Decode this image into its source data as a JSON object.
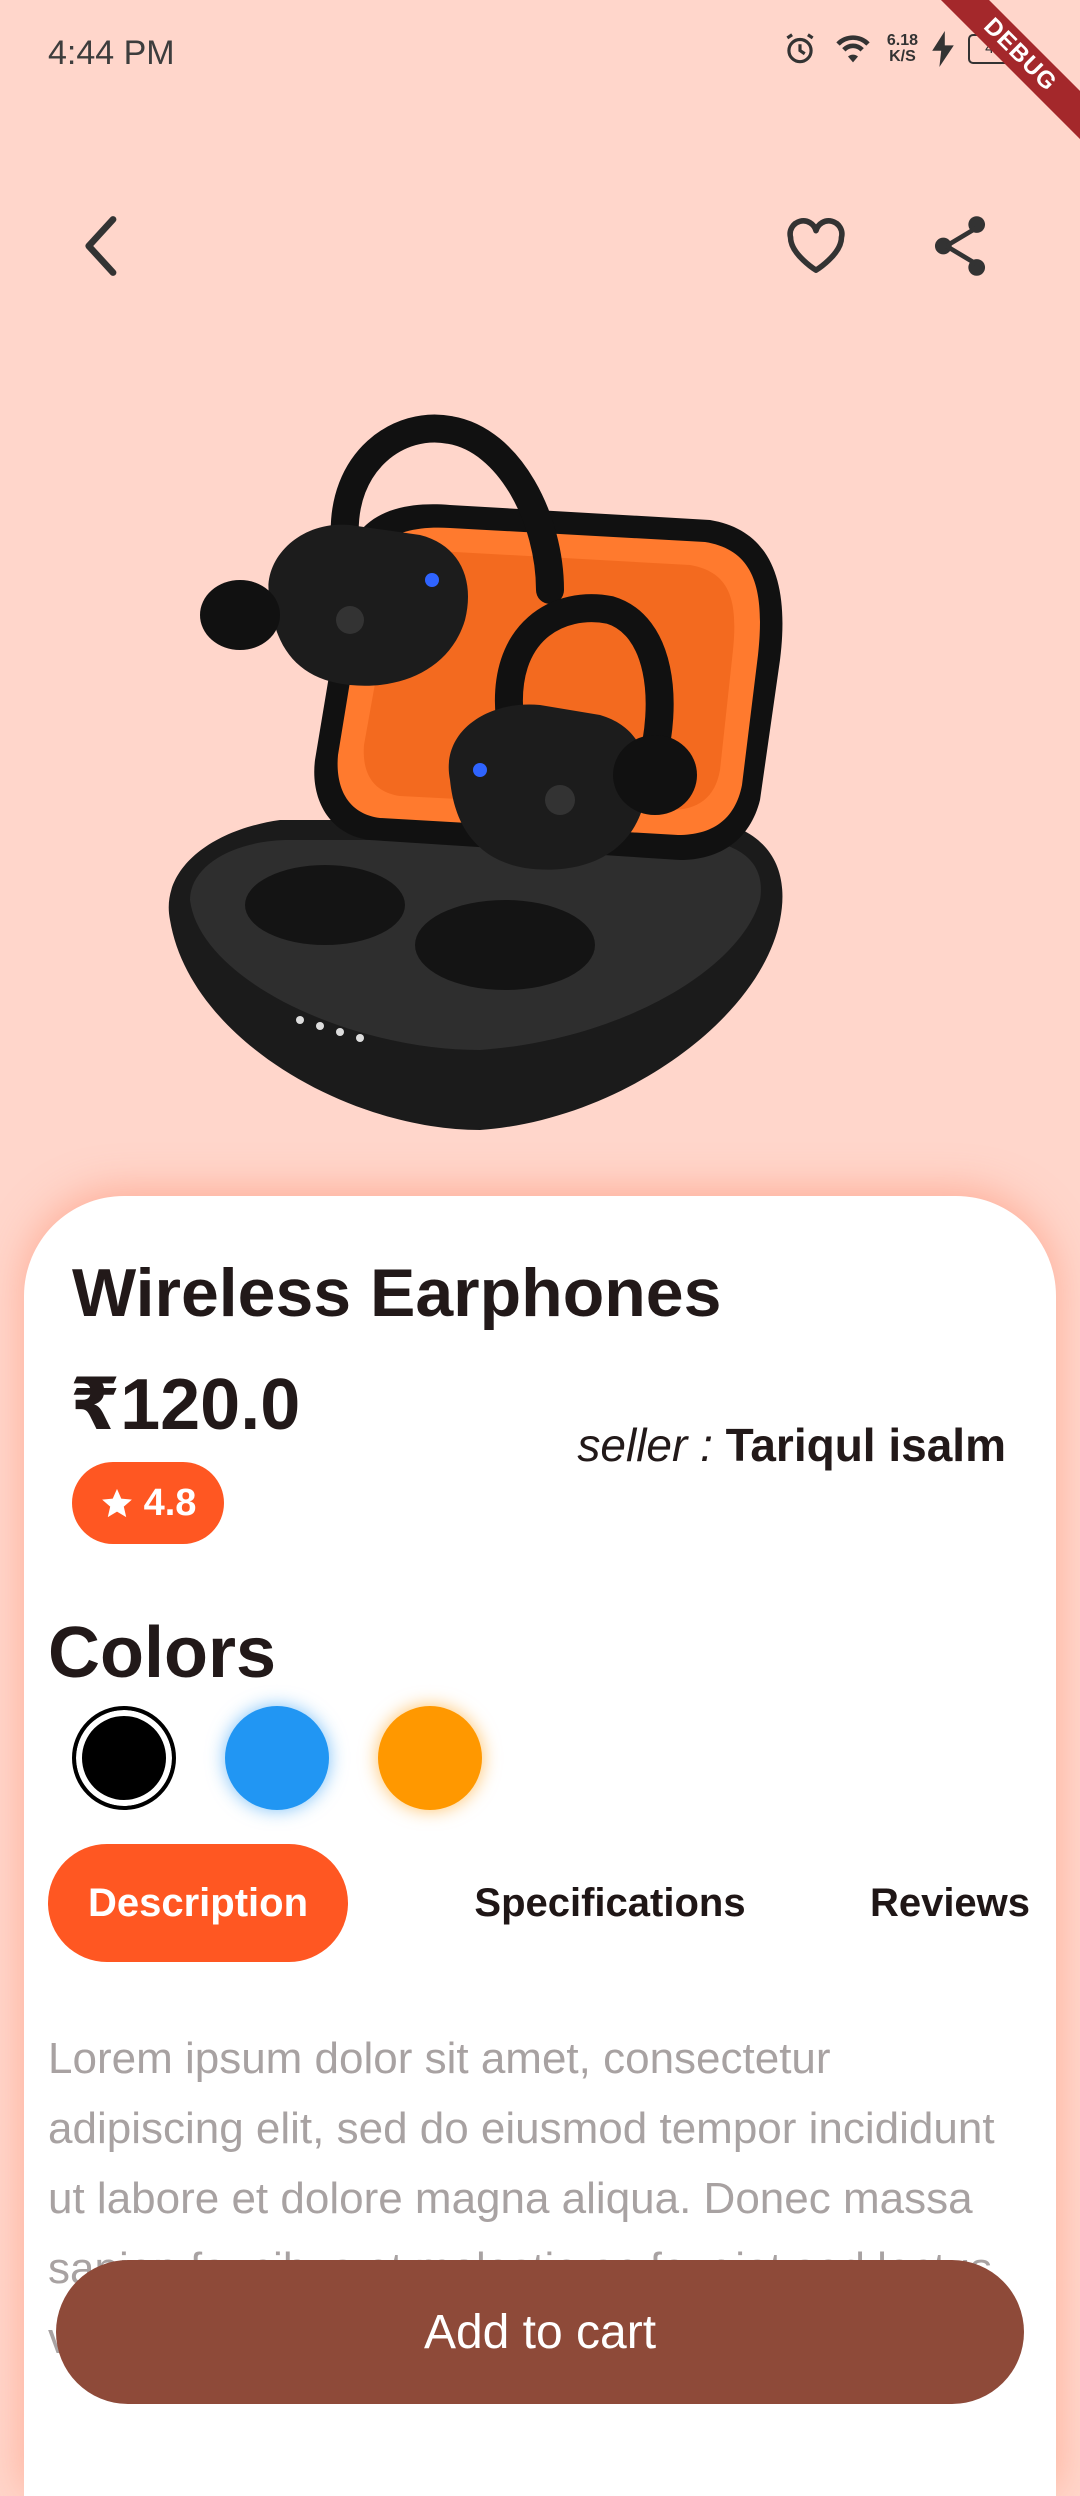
{
  "status": {
    "time": "4:44 PM",
    "net_speed_value": "6.18",
    "net_speed_unit": "K/S",
    "battery": "49",
    "debug_label": "DEBUG"
  },
  "header": {
    "back_icon": "chevron-left-icon",
    "favorite_icon": "heart-outline-icon",
    "share_icon": "share-icon"
  },
  "product": {
    "title": "Wireless Earphones",
    "price": "₹120.0",
    "rating": "4.8",
    "seller_label": "seller : ",
    "seller_name": "Tariqul isalm",
    "image_icon": "earphones-case-image"
  },
  "colors": {
    "heading": "Colors",
    "swatches": [
      {
        "name": "black",
        "hex": "#000000",
        "selected": true
      },
      {
        "name": "blue",
        "hex": "#2196F3",
        "selected": false
      },
      {
        "name": "orange",
        "hex": "#FF9800",
        "selected": false
      }
    ]
  },
  "tabs": [
    {
      "label": "Description",
      "active": true
    },
    {
      "label": "Specifications",
      "active": false
    },
    {
      "label": "Reviews",
      "active": false
    }
  ],
  "description": "Lorem ipsum dolor sit amet, consectetur adipiscing elit, sed do eiusmod tempor incididunt ut labore et dolore magna aliqua. Donec massa sapien faucibus et molestie ac feugiat sed lectus vestibulum mattis. Libero id faucibus nisl tincidunt.",
  "cart": {
    "label": "Add to cart"
  },
  "theme": {
    "background": "#FFD6CB",
    "accent": "#FF5722",
    "cart_button": "#8E4A39"
  }
}
